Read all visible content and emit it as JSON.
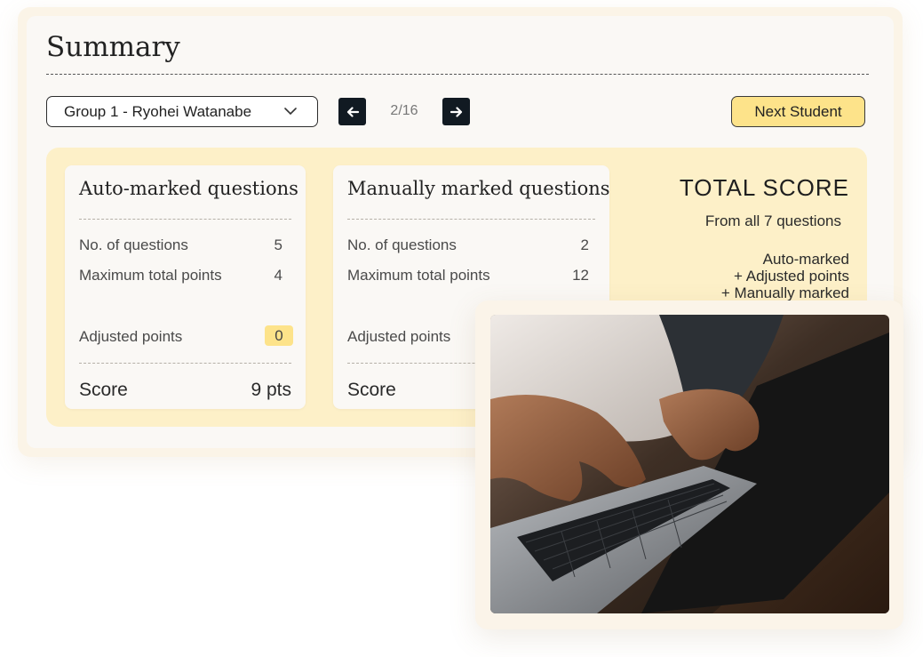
{
  "summary": {
    "title": "Summary",
    "student_select": {
      "value": "Group 1 - Ryohei Watanabe"
    },
    "pager": {
      "current": "2/16"
    },
    "next_student_label": "Next Student"
  },
  "cards": {
    "auto": {
      "title": "Auto-marked questions",
      "num_questions_label": "No. of questions",
      "num_questions_value": "5",
      "max_points_label": "Maximum total points",
      "max_points_value": "4",
      "adjusted_label": "Adjusted points",
      "adjusted_value": "0",
      "score_label": "Score",
      "score_value": "9 pts"
    },
    "manual": {
      "title": "Manually marked questions",
      "num_questions_label": "No. of questions",
      "num_questions_value": "2",
      "max_points_label": "Maximum total points",
      "max_points_value": "12",
      "adjusted_label": "Adjusted points",
      "score_label": "Score"
    }
  },
  "total": {
    "title": "TOTAL SCORE",
    "subtitle": "From all 7 questions",
    "lines": [
      "Auto-marked",
      "+ Adjusted points",
      "+ Manually marked"
    ]
  },
  "colors": {
    "accent_yellow": "#fde38a",
    "summary_background": "#fdf0c8",
    "nav_button": "#111a22"
  },
  "icons": {
    "dropdown": "chevron-down-icon",
    "prev": "arrow-left-icon",
    "next": "arrow-right-icon"
  }
}
